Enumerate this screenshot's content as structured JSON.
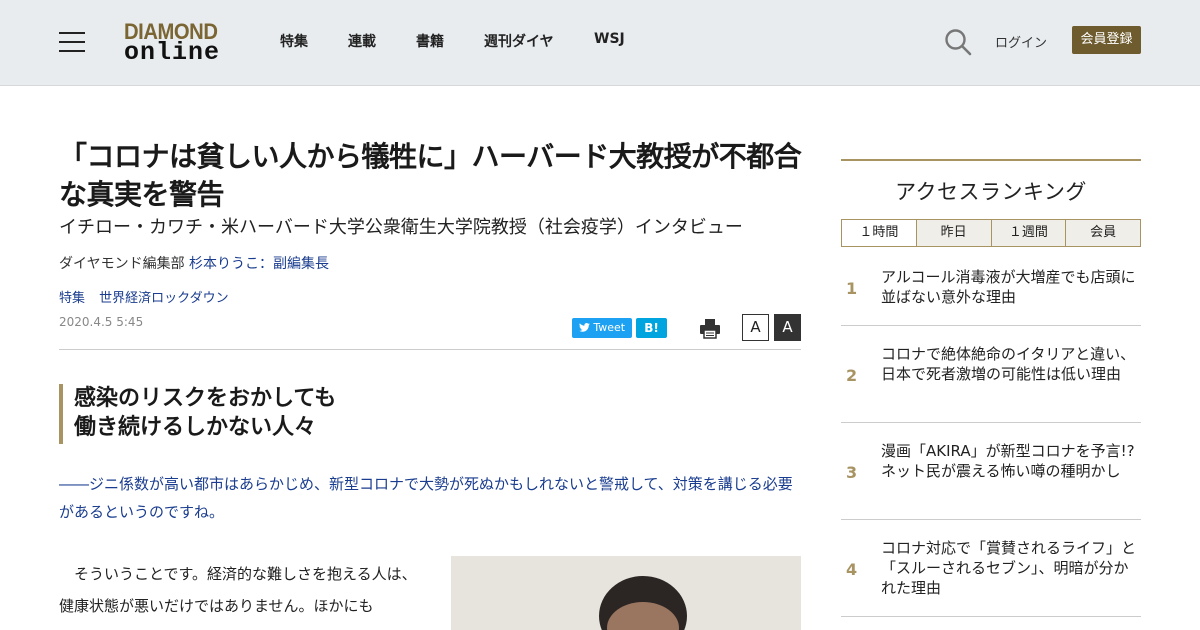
{
  "header": {
    "logo_line1": "DIAMOND",
    "logo_line2": "online",
    "nav": [
      "特集",
      "連載",
      "書籍",
      "週刊ダイヤ",
      "WSJ"
    ],
    "login": "ログイン",
    "register": "会員登録"
  },
  "article": {
    "title": "「コロナは貧しい人から犠牲に」ハーバード大教授が不都合な真実を警告",
    "subtitle": "イチロー・カワチ・米ハーバード大学公衆衛生大学院教授（社会疫学）インタビュー",
    "byline_prefix": "ダイヤモンド編集部",
    "byline_author": "杉本りうこ：副編集長",
    "tags": [
      "特集",
      "世界経済ロックダウン"
    ],
    "date": "2020.4.5 5:45",
    "tweet": "Tweet",
    "hatena": "B!",
    "font_small": "A",
    "font_large": "A",
    "section_heading_1": "感染のリスクをおかしても",
    "section_heading_2": "働き続けるしかない人々",
    "question": "――ジニ係数が高い都市はあらかじめ、新型コロナで大勢が死ぬかもしれないと警戒して、対策を講じる必要があるというのですね。",
    "body": "　そういうことです。経済的な難しさを抱える人は、健康状態が悪いだけではありません。ほかにも"
  },
  "ranking": {
    "title": "アクセスランキング",
    "tabs": [
      "１時間",
      "昨日",
      "１週間",
      "会員"
    ],
    "items": [
      {
        "rank": "1",
        "text": "アルコール消毒液が大増産でも店頭に並ばない意外な理由"
      },
      {
        "rank": "2",
        "text": "コロナで絶体絶命のイタリアと違い、日本で死者激増の可能性は低い理由"
      },
      {
        "rank": "3",
        "text": "漫画「AKIRA」が新型コロナを予言!?ネット民が震える怖い噂の種明かし"
      },
      {
        "rank": "4",
        "text": "コロナ対応で「賞賛されるライフ」と「スルーされるセブン」、明暗が分かれた理由"
      }
    ]
  },
  "colors": {
    "brand_gold": "#a89462",
    "register_bg": "#6e5c2e",
    "link_blue": "#1a3d8f",
    "header_bg": "#e8ecef"
  }
}
